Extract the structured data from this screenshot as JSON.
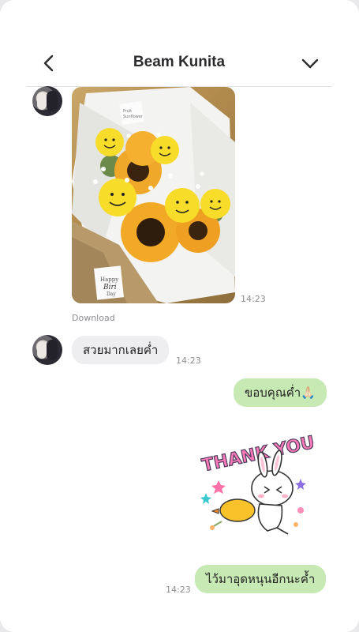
{
  "header": {
    "title": "Beam Kunita"
  },
  "messages": {
    "photo": {
      "time": "14:23",
      "download_label": "Download",
      "card_text": "Happy Biri Day",
      "tag_text": "Fruit Sunflower"
    },
    "incoming_text": {
      "text": "สวยมากเลยค่ำ",
      "time": "14:23"
    },
    "outgoing_thanks": {
      "text": "ขอบคุณค่ำ🙏🏻"
    },
    "sticker": {
      "text": "THANK YOU!"
    },
    "outgoing_last": {
      "text": "ไว้มาอุดหนุนอีกนะค้ำ",
      "time": "14:23"
    }
  },
  "colors": {
    "outgoing_bubble": "#c7eab4",
    "incoming_bubble": "#eeeef1",
    "header_text": "#2b2b2e",
    "timestamp": "#8d8d92"
  }
}
